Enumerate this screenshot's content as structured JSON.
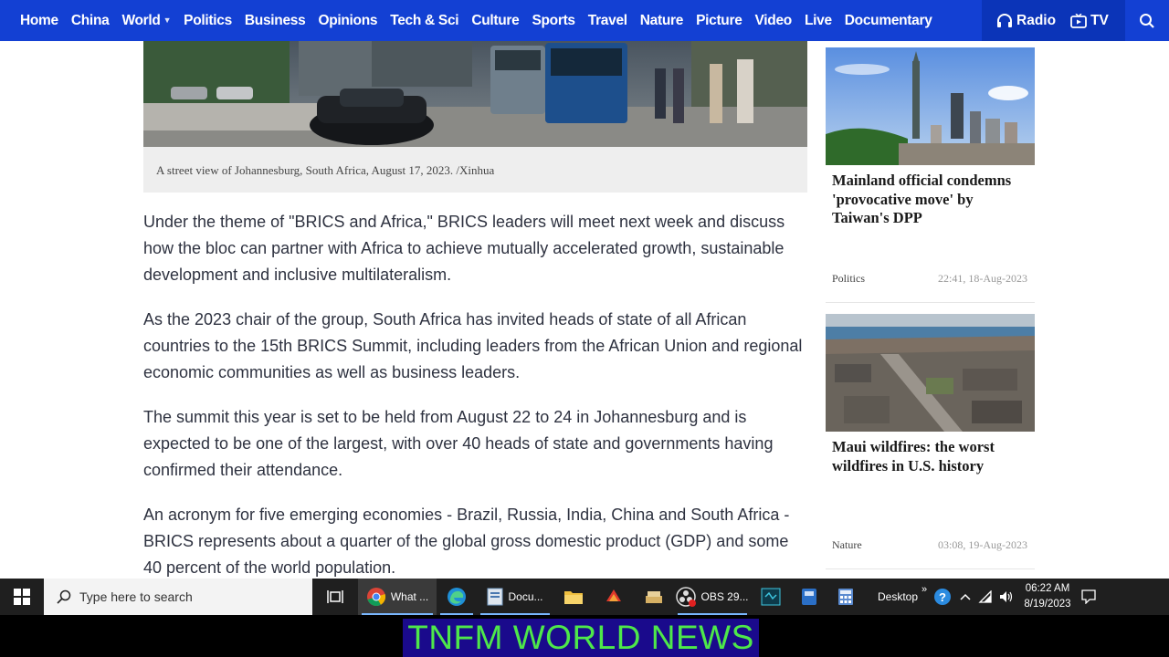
{
  "nav": {
    "links": [
      "Home",
      "China",
      "World",
      "Politics",
      "Business",
      "Opinions",
      "Tech & Sci",
      "Culture",
      "Sports",
      "Travel",
      "Nature",
      "Picture",
      "Video",
      "Live",
      "Documentary"
    ],
    "world_caret": "▼",
    "radio_label": "Radio",
    "tv_label": "TV"
  },
  "article": {
    "caption": "A street view of Johannesburg, South Africa, August 17, 2023. /Xinhua",
    "paragraphs": [
      "Under the theme of \"BRICS and Africa,\" BRICS leaders will meet next week and discuss how the bloc can partner with Africa to achieve mutually accelerated growth, sustainable development and inclusive multilateralism.",
      "As the 2023 chair of the group, South Africa has invited heads of state of all African countries to the 15th BRICS Summit, including leaders from the African Union and regional economic communities as well as business leaders.",
      "The summit this year is set to be held from August 22 to 24 in Johannesburg and is expected to be one of the largest, with over 40 heads of state and governments having confirmed their attendance.",
      "An acronym for five emerging economies - Brazil, Russia, India, China and South Africa - BRICS represents about a quarter of the global gross domestic product (GDP) and some 40 percent of the world population."
    ]
  },
  "sidebar": {
    "cards": [
      {
        "title": "Mainland official condemns 'provocative move' by Taiwan's DPP",
        "category": "Politics",
        "time": "22:41, 18-Aug-2023"
      },
      {
        "title": "Maui wildfires: the worst wildfires in U.S. history",
        "category": "Nature",
        "time": "03:08, 19-Aug-2023"
      }
    ]
  },
  "taskbar": {
    "search_placeholder": "Type here to search",
    "chrome_label": "What ...",
    "docs_label": "Docu...",
    "obs_label": "OBS 29...",
    "desktop_label": "Desktop",
    "overflow": "»",
    "time": "06:22 AM",
    "date": "8/19/2023"
  },
  "banner": {
    "text": "TNFM WORLD NEWS"
  },
  "colors": {
    "nav_bg": "#1340d3",
    "radio_bg": "#0b34b8",
    "banner_bg": "#1a0a8c",
    "banner_text": "#4ee84a",
    "taskbar_bg": "#1f1f1f"
  }
}
